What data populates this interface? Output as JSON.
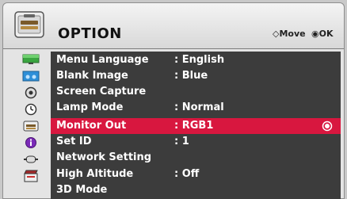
{
  "header": {
    "title": "OPTION",
    "icon": "option-tool-icon",
    "move_hint": "Move",
    "ok_hint": "OK",
    "move_icon": "four-way-arrow-icon",
    "ok_icon": "ok-button-icon"
  },
  "sidebar": {
    "items": [
      {
        "icon": "picture-icon"
      },
      {
        "icon": "audio-icon"
      },
      {
        "icon": "settings-disc-icon"
      },
      {
        "icon": "time-icon"
      },
      {
        "icon": "option-icon"
      },
      {
        "icon": "info-icon"
      },
      {
        "icon": "input-icon"
      },
      {
        "icon": "media-icon"
      }
    ]
  },
  "menu": {
    "items": [
      {
        "label": "Menu Language",
        "value": ": English"
      },
      {
        "label": "Blank Image",
        "value": ": Blue"
      },
      {
        "label": "Screen Capture",
        "value": ""
      },
      {
        "label": "Lamp Mode",
        "value": ": Normal"
      },
      {
        "label": "Monitor Out",
        "value": ": RGB1",
        "selected": true
      },
      {
        "label": "Set ID",
        "value": ": 1"
      },
      {
        "label": "Network Setting",
        "value": ""
      },
      {
        "label": "High Altitude",
        "value": ": Off"
      },
      {
        "label": "3D Mode",
        "value": ""
      }
    ]
  },
  "colors": {
    "selection": "#d8173f",
    "list_background": "#3c3c3c",
    "text": "#ffffff"
  }
}
